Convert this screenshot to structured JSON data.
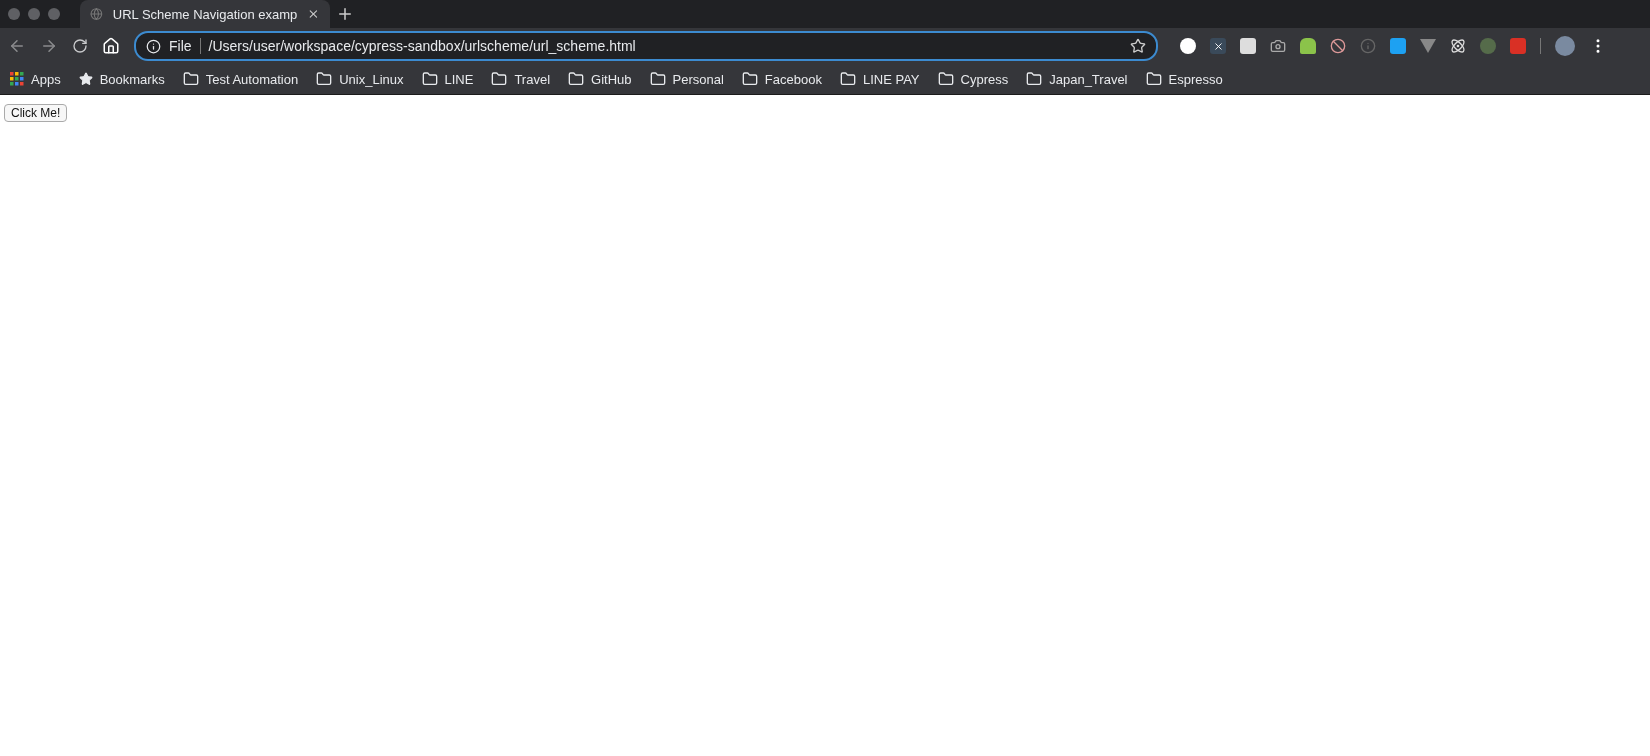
{
  "tab": {
    "title": "URL Scheme Navigation examp",
    "selected": true
  },
  "address_bar": {
    "scheme_label": "File",
    "url": "/Users/user/workspace/cypress-sandbox/urlscheme/url_scheme.html"
  },
  "bookmarks": [
    {
      "kind": "apps",
      "label": "Apps"
    },
    {
      "kind": "star",
      "label": "Bookmarks"
    },
    {
      "kind": "folder",
      "label": "Test Automation"
    },
    {
      "kind": "folder",
      "label": "Unix_Linux"
    },
    {
      "kind": "folder",
      "label": "LINE"
    },
    {
      "kind": "folder",
      "label": "Travel"
    },
    {
      "kind": "folder",
      "label": "GitHub"
    },
    {
      "kind": "folder",
      "label": "Personal"
    },
    {
      "kind": "folder",
      "label": "Facebook"
    },
    {
      "kind": "folder",
      "label": "LINE PAY"
    },
    {
      "kind": "folder",
      "label": "Cypress"
    },
    {
      "kind": "folder",
      "label": "Japan_Travel"
    },
    {
      "kind": "folder",
      "label": "Espresso"
    }
  ],
  "page": {
    "button": "Click Me!"
  }
}
